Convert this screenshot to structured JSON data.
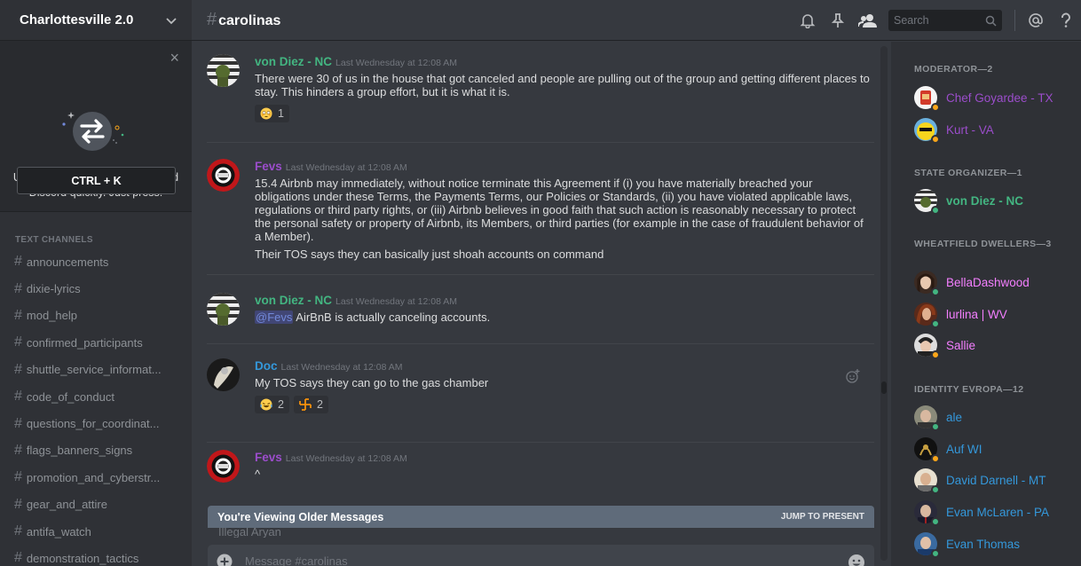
{
  "server": {
    "name": "Charlottesville 2.0"
  },
  "quick_switcher": {
    "text": "Use Quick Switcher to get around Discord quickly. Just press:",
    "shortcut": "CTRL + K",
    "close": "×"
  },
  "sidebar": {
    "category": "TEXT CHANNELS",
    "channels": [
      "announcements",
      "dixie-lyrics",
      "mod_help",
      "confirmed_participants",
      "shuttle_service_informat...",
      "code_of_conduct",
      "questions_for_coordinat...",
      "flags_banners_signs",
      "promotion_and_cyberstr...",
      "gear_and_attire",
      "antifa_watch",
      "demonstration_tactics"
    ]
  },
  "header": {
    "hash": "#",
    "channel": "carolinas",
    "search_placeholder": "Search"
  },
  "messages": [
    {
      "author": "von Diez - NC",
      "author_color": "#43b581",
      "timestamp": "Last Wednesday at 12:08 AM",
      "lines": [
        "There were 30 of us in the house that got canceled and people are pulling out of the group and getting different places to stay. This hinders a group effort, but it is what it is."
      ],
      "reactions": [
        {
          "emoji": "flushed-face",
          "count": "1"
        }
      ]
    },
    {
      "author": "Fevs",
      "author_color": "#9b4dcb",
      "timestamp": "Last Wednesday at 12:08 AM",
      "lines": [
        "15.4 Airbnb may immediately, without notice terminate this Agreement if (i) you have materially breached your obligations under these Terms, the Payments Terms, our Policies or Standards, (ii) you have violated applicable laws, regulations or third party rights, or (iii) Airbnb believes in good faith that such action is reasonably necessary to protect the personal safety or property of Airbnb, its Members, or third parties (for example in the case of fraudulent behavior of a Member).",
        "Their TOS says they can basically just shoah accounts on command"
      ]
    },
    {
      "author": "von Diez - NC",
      "author_color": "#43b581",
      "timestamp": "Last Wednesday at 12:08 AM",
      "mention": "@Fevs",
      "text_after_mention": " AirBnB is actually canceling accounts."
    },
    {
      "author": "Doc",
      "author_color": "#3498db",
      "timestamp": "Last Wednesday at 12:08 AM",
      "lines": [
        "My TOS says they can go to the gas chamber"
      ],
      "reactions": [
        {
          "emoji": "joy-face",
          "count": "2"
        },
        {
          "emoji": "symbol",
          "count": "2"
        }
      ]
    },
    {
      "author": "Fevs",
      "author_color": "#9b4dcb",
      "timestamp": "Last Wednesday at 12:08 AM",
      "lines": [
        "^"
      ]
    }
  ],
  "older_bar": {
    "label": "You're Viewing Older Messages",
    "jump": "JUMP TO PRESENT",
    "ghost_text": "Illegal Aryan"
  },
  "composer": {
    "placeholder": "Message #carolinas"
  },
  "member_list": {
    "roles": [
      {
        "title": "MODERATOR—2",
        "members": [
          {
            "name": "Chef Goyardee - TX",
            "color": "#9b4dcb",
            "status": "idle"
          },
          {
            "name": "Kurt - VA",
            "color": "#9b4dcb",
            "status": "idle"
          }
        ]
      },
      {
        "title": "STATE ORGANIZER—1",
        "members": [
          {
            "name": "von Diez - NC",
            "color": "#43b581",
            "status": "online"
          }
        ]
      },
      {
        "title": "WHEATFIELD DWELLERS—3",
        "members": [
          {
            "name": "BellaDashwood",
            "color": "#f47fff",
            "status": "online"
          },
          {
            "name": "lurlina | WV",
            "color": "#f47fff",
            "status": "online"
          },
          {
            "name": "Sallie",
            "color": "#f47fff",
            "status": "idle"
          }
        ]
      },
      {
        "title": "IDENTITY EVROPA—12",
        "members": [
          {
            "name": "ale",
            "color": "#3498db",
            "status": "online"
          },
          {
            "name": "Auf WI",
            "color": "#3498db",
            "status": "idle"
          },
          {
            "name": "David Darnell - MT",
            "color": "#3498db",
            "status": "online"
          },
          {
            "name": "Evan McLaren - PA",
            "color": "#3498db",
            "status": "online"
          },
          {
            "name": "Evan Thomas",
            "color": "#3498db",
            "status": "online"
          }
        ]
      }
    ]
  },
  "colors": {
    "online": "#43b581",
    "idle": "#faa61a",
    "mention_bg": "#414675",
    "mention_fg": "#7289da"
  }
}
